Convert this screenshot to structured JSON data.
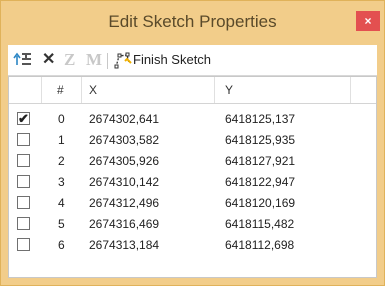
{
  "window": {
    "title": "Edit Sketch Properties",
    "close_label": "×"
  },
  "toolbar": {
    "z_label": "Z",
    "m_label": "M",
    "finish_label": "Finish Sketch"
  },
  "grid": {
    "columns": [
      "#",
      "X",
      "Y"
    ],
    "rows": [
      {
        "checked": true,
        "check_mark": "✔",
        "index": "0",
        "x": "2674302,641",
        "y": "6418125,137"
      },
      {
        "checked": false,
        "check_mark": "",
        "index": "1",
        "x": "2674303,582",
        "y": "6418125,935"
      },
      {
        "checked": false,
        "check_mark": "",
        "index": "2",
        "x": "2674305,926",
        "y": "6418127,921"
      },
      {
        "checked": false,
        "check_mark": "",
        "index": "3",
        "x": "2674310,142",
        "y": "6418122,947"
      },
      {
        "checked": false,
        "check_mark": "",
        "index": "4",
        "x": "2674312,496",
        "y": "6418120,169"
      },
      {
        "checked": false,
        "check_mark": "",
        "index": "5",
        "x": "2674316,469",
        "y": "6418115,482"
      },
      {
        "checked": false,
        "check_mark": "",
        "index": "6",
        "x": "2674313,184",
        "y": "6418112,698"
      }
    ]
  },
  "colors": {
    "title_bar": "#f2cd8a",
    "close": "#e35050",
    "panel": "#ffffff"
  }
}
